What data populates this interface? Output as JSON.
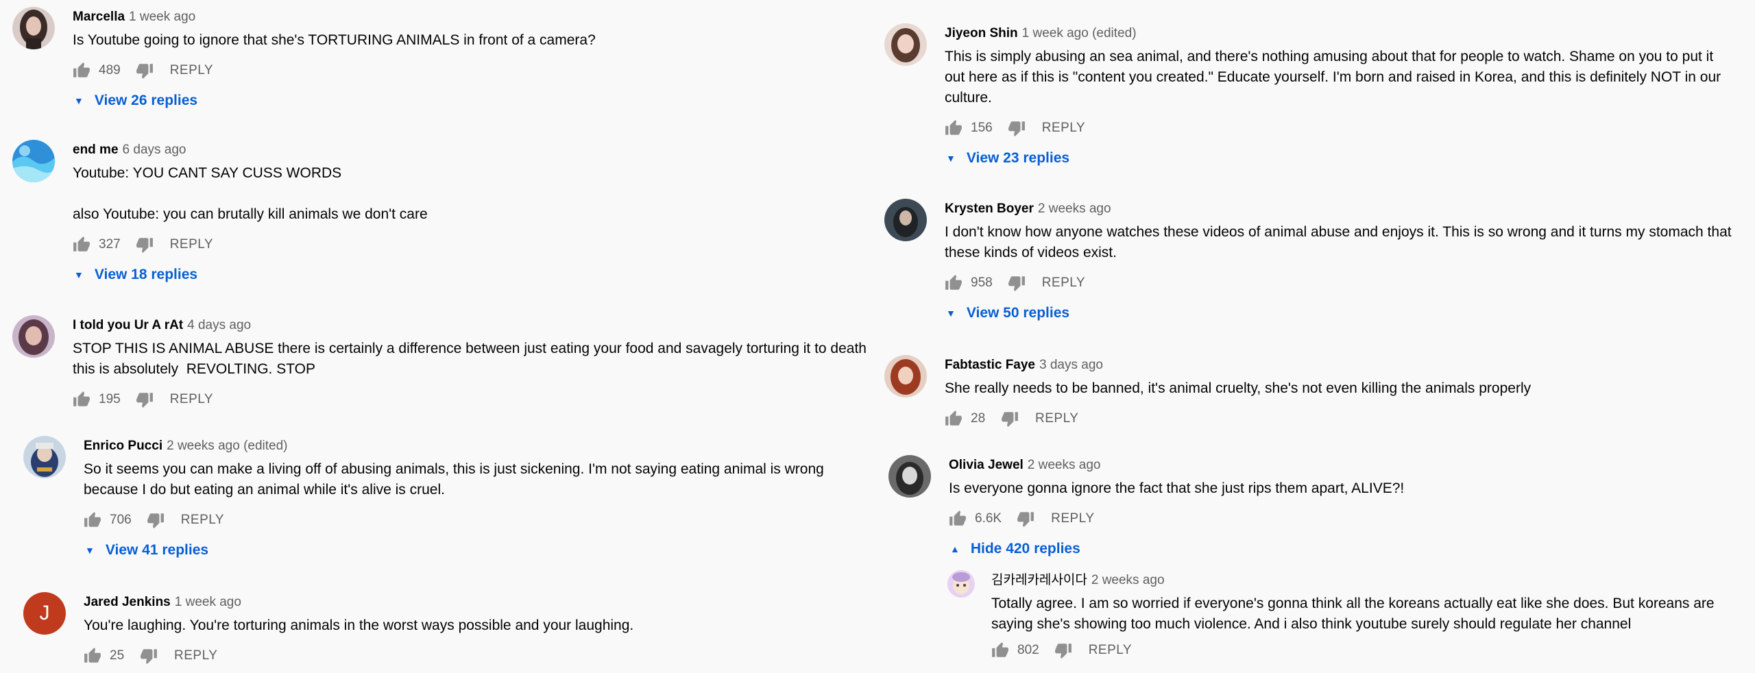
{
  "comments": [
    {
      "author": "Marcella",
      "time": "1 week ago",
      "text": "Is Youtube going to ignore that she's TORTURING ANIMALS in front of a camera?",
      "likes": "489",
      "reply": "REPLY",
      "replies": "View 26 replies"
    },
    {
      "author": "end me",
      "time": "6 days ago",
      "text": "Youtube: YOU CANT SAY CUSS WORDS\n\nalso Youtube: you can brutally kill animals we don't care",
      "likes": "327",
      "reply": "REPLY",
      "replies": "View 18 replies"
    },
    {
      "author": "I told you Ur A rAt",
      "time": "4 days ago",
      "text": "STOP THIS IS ANIMAL ABUSE there is certainly a difference between just eating your food and savagely torturing it to death this is absolutely  REVOLTING. STOP",
      "likes": "195",
      "reply": "REPLY"
    },
    {
      "author": "Enrico Pucci",
      "time": "2 weeks ago (edited)",
      "text": "So it seems you can make a living off of abusing animals, this is just sickening. I'm not saying eating animal is wrong because I do but eating an animal while it's alive is cruel.",
      "likes": "706",
      "reply": "REPLY",
      "replies": "View 41 replies"
    },
    {
      "author": "Jared Jenkins",
      "time": "1 week ago",
      "text": "You're laughing. You're torturing animals in the worst ways possible and your laughing.",
      "likes": "25",
      "reply": "REPLY",
      "avatar_initial": "J"
    },
    {
      "author": "Jiyeon Shin",
      "time": "1 week ago (edited)",
      "text": "This is simply abusing an sea animal, and there's nothing amusing about that for people to watch. Shame on you to put it out here as if this is \"content you created.\" Educate yourself. I'm born and raised in Korea, and this is definitely NOT in our culture.",
      "likes": "156",
      "reply": "REPLY",
      "replies": "View 23 replies"
    },
    {
      "author": "Krysten Boyer",
      "time": "2 weeks ago",
      "text": "I don't know how anyone watches these videos of animal abuse and enjoys it. This is so wrong and it turns my stomach that these kinds of videos exist.",
      "likes": "958",
      "reply": "REPLY",
      "replies": "View 50 replies"
    },
    {
      "author": "Fabtastic Faye",
      "time": "3 days ago",
      "text": "She really needs to be banned, it's animal cruelty, she's not even killing the animals properly",
      "likes": "28",
      "reply": "REPLY"
    },
    {
      "author": "Olivia Jewel",
      "time": "2 weeks ago",
      "text": "Is everyone gonna ignore the fact that she just rips them apart, ALIVE?!",
      "likes": "6.6K",
      "reply": "REPLY",
      "replies": "Hide 420 replies"
    },
    {
      "author": "김카레카레사이다",
      "time": "2 weeks ago",
      "text": "Totally agree. I am so worried if everyone's gonna think all the koreans actually eat like she does. But koreans are  saying she's showing too much violence. And i also think youtube surely should regulate her channel",
      "likes": "802",
      "reply": "REPLY"
    }
  ],
  "colors": {
    "link": "#065fd4",
    "meta": "#606060",
    "text": "#030303",
    "bg": "#f9f9f9"
  },
  "icons": {
    "like": "thumb-up-icon",
    "dislike": "thumb-down-icon",
    "expand": "caret-down-icon",
    "collapse": "caret-up-icon"
  }
}
